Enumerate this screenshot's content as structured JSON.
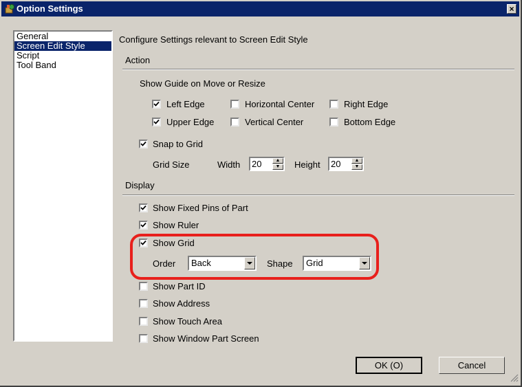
{
  "window": {
    "title": "Option Settings",
    "close_glyph": "×"
  },
  "sidebar": {
    "items": [
      {
        "label": "General",
        "selected": false
      },
      {
        "label": "Screen Edit Style",
        "selected": true
      },
      {
        "label": "Script",
        "selected": false
      },
      {
        "label": "Tool Band",
        "selected": false
      }
    ]
  },
  "header": "Configure Settings relevant to Screen Edit Style",
  "action": {
    "label": "Action",
    "guide_label": "Show Guide on Move or Resize",
    "guides": {
      "left_edge": {
        "label": "Left Edge",
        "checked": true
      },
      "horizontal_center": {
        "label": "Horizontal Center",
        "checked": false
      },
      "right_edge": {
        "label": "Right Edge",
        "checked": false
      },
      "upper_edge": {
        "label": "Upper Edge",
        "checked": true
      },
      "vertical_center": {
        "label": "Vertical Center",
        "checked": false
      },
      "bottom_edge": {
        "label": "Bottom Edge",
        "checked": false
      }
    },
    "snap": {
      "label": "Snap to Grid",
      "checked": true
    },
    "grid_size_label": "Grid Size",
    "width_label": "Width",
    "width_value": "20",
    "height_label": "Height",
    "height_value": "20"
  },
  "display": {
    "label": "Display",
    "fixed_pins": {
      "label": "Show Fixed Pins of Part",
      "checked": true
    },
    "ruler": {
      "label": "Show Ruler",
      "checked": true
    },
    "grid": {
      "label": "Show Grid",
      "checked": true
    },
    "order_label": "Order",
    "order_value": "Back",
    "shape_label": "Shape",
    "shape_value": "Grid",
    "part_id": {
      "label": "Show Part ID",
      "checked": false
    },
    "address": {
      "label": "Show Address",
      "checked": false
    },
    "touch_area": {
      "label": "Show Touch Area",
      "checked": false
    },
    "window_part": {
      "label": "Show Window Part Screen",
      "checked": false
    }
  },
  "buttons": {
    "ok": "OK (O)",
    "cancel": "Cancel"
  },
  "colors": {
    "title_bar": "#0a246a",
    "face": "#d4d0c8",
    "highlight": "#e8201c"
  }
}
